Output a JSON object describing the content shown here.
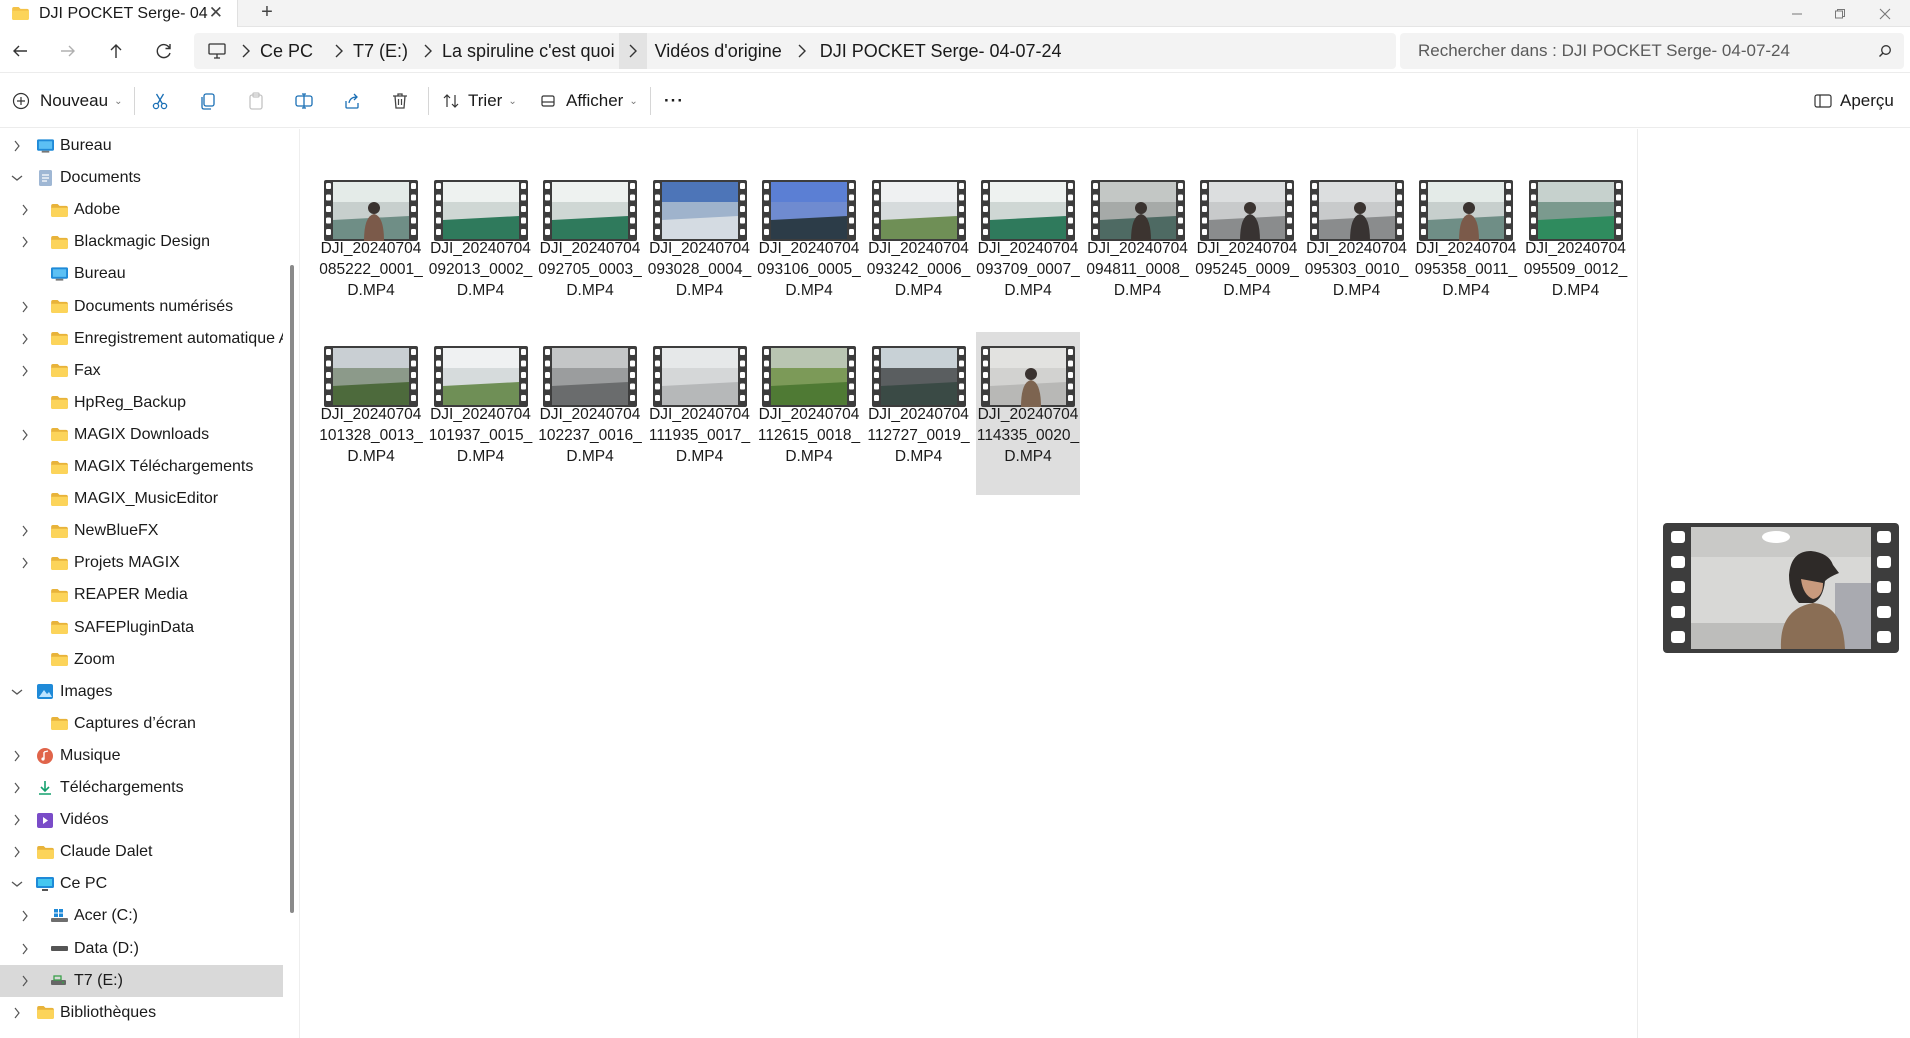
{
  "window": {
    "tab_title": "DJI POCKET Serge- 04",
    "new_tab_label": "+",
    "close_tab_label": "✕"
  },
  "address": {
    "crumbs": [
      "Ce PC",
      "T7 (E:)",
      "La spiruline c'est quoi",
      "Vidéos d'origine",
      "DJI POCKET Serge- 04-07-24"
    ]
  },
  "search": {
    "placeholder": "Rechercher dans : DJI POCKET Serge- 04-07-24"
  },
  "toolbar": {
    "new_label": "Nouveau",
    "sort_label": "Trier",
    "view_label": "Afficher",
    "more_label": "···",
    "preview_label": "Aperçu"
  },
  "nav_pane": {
    "items": [
      {
        "label": "Bureau",
        "level": 0,
        "expander": "collapsed",
        "icon": "desktop-icon"
      },
      {
        "label": "Documents",
        "level": 0,
        "expander": "expanded",
        "icon": "documents-icon"
      },
      {
        "label": "Adobe",
        "level": 1,
        "expander": "collapsed",
        "icon": "folder-icon"
      },
      {
        "label": "Blackmagic Design",
        "level": 1,
        "expander": "collapsed",
        "icon": "folder-icon"
      },
      {
        "label": "Bureau",
        "level": 1,
        "expander": "none",
        "icon": "desktop-icon"
      },
      {
        "label": "Documents numérisés",
        "level": 1,
        "expander": "collapsed",
        "icon": "folder-icon"
      },
      {
        "label": "Enregistrement automatique Ad",
        "level": 1,
        "expander": "collapsed",
        "icon": "folder-icon"
      },
      {
        "label": "Fax",
        "level": 1,
        "expander": "collapsed",
        "icon": "folder-icon"
      },
      {
        "label": "HpReg_Backup",
        "level": 1,
        "expander": "none",
        "icon": "folder-icon"
      },
      {
        "label": "MAGIX Downloads",
        "level": 1,
        "expander": "collapsed",
        "icon": "folder-icon"
      },
      {
        "label": "MAGIX Téléchargements",
        "level": 1,
        "expander": "none",
        "icon": "folder-icon"
      },
      {
        "label": "MAGIX_MusicEditor",
        "level": 1,
        "expander": "none",
        "icon": "folder-icon"
      },
      {
        "label": "NewBlueFX",
        "level": 1,
        "expander": "collapsed",
        "icon": "folder-icon"
      },
      {
        "label": "Projets MAGIX",
        "level": 1,
        "expander": "collapsed",
        "icon": "folder-icon"
      },
      {
        "label": "REAPER Media",
        "level": 1,
        "expander": "none",
        "icon": "folder-icon"
      },
      {
        "label": "SAFEPluginData",
        "level": 1,
        "expander": "none",
        "icon": "folder-icon"
      },
      {
        "label": "Zoom",
        "level": 1,
        "expander": "none",
        "icon": "folder-icon"
      },
      {
        "label": "Images",
        "level": 0,
        "expander": "expanded",
        "icon": "images-icon"
      },
      {
        "label": "Captures d’écran",
        "level": 1,
        "expander": "none",
        "icon": "folder-icon"
      },
      {
        "label": "Musique",
        "level": 0,
        "expander": "collapsed",
        "icon": "music-icon"
      },
      {
        "label": "Téléchargements",
        "level": 0,
        "expander": "collapsed",
        "icon": "download-icon"
      },
      {
        "label": "Vidéos",
        "level": 0,
        "expander": "collapsed",
        "icon": "videos-icon"
      },
      {
        "label": "Claude Dalet",
        "level": 0,
        "expander": "collapsed",
        "icon": "folder-icon"
      },
      {
        "label": "Ce PC",
        "level": 0,
        "expander": "expanded",
        "icon": "pc-icon"
      },
      {
        "label": "Acer (C:)",
        "level": 1,
        "expander": "collapsed",
        "icon": "windows-drive-icon"
      },
      {
        "label": "Data (D:)",
        "level": 1,
        "expander": "collapsed",
        "icon": "drive-icon"
      },
      {
        "label": "T7 (E:)",
        "level": 1,
        "expander": "collapsed",
        "icon": "usb-drive-icon",
        "selected": true
      },
      {
        "label": "Bibliothèques",
        "level": 0,
        "expander": "collapsed",
        "icon": "folder-icon"
      }
    ]
  },
  "files": [
    {
      "name": "DJI_20240704085222_0001_D.MP4",
      "scene": "greenhouse-person"
    },
    {
      "name": "DJI_20240704092013_0002_D.MP4",
      "scene": "greenhouse-basin"
    },
    {
      "name": "DJI_20240704092705_0003_D.MP4",
      "scene": "greenhouse-basin"
    },
    {
      "name": "DJI_20240704093028_0004_D.MP4",
      "scene": "greenhouse-exterior"
    },
    {
      "name": "DJI_20240704093106_0005_D.MP4",
      "scene": "solar-field"
    },
    {
      "name": "DJI_20240704093242_0006_D.MP4",
      "scene": "greenhouse-wall"
    },
    {
      "name": "DJI_20240704093709_0007_D.MP4",
      "scene": "greenhouse-basin"
    },
    {
      "name": "DJI_20240704094811_0008_D.MP4",
      "scene": "person-basin"
    },
    {
      "name": "DJI_20240704095245_0009_D.MP4",
      "scene": "person-room"
    },
    {
      "name": "DJI_20240704095303_0010_D.MP4",
      "scene": "person-room"
    },
    {
      "name": "DJI_20240704095358_0011_D.MP4",
      "scene": "greenhouse-person"
    },
    {
      "name": "DJI_20240704095509_0012_D.MP4",
      "scene": "green-basin"
    },
    {
      "name": "DJI_20240704101328_0013_D.MP4",
      "scene": "outdoor-building"
    },
    {
      "name": "DJI_20240704101937_0015_D.MP4",
      "scene": "greenhouse-wall"
    },
    {
      "name": "DJI_20240704102237_0016_D.MP4",
      "scene": "dark-interior"
    },
    {
      "name": "DJI_20240704111935_0017_D.MP4",
      "scene": "white-room"
    },
    {
      "name": "DJI_20240704112615_0018_D.MP4",
      "scene": "grass"
    },
    {
      "name": "DJI_20240704112727_0019_D.MP4",
      "scene": "dark-room"
    },
    {
      "name": "DJI_20240704114335_0020_D.MP4",
      "scene": "person-cap",
      "selected": true
    }
  ],
  "colors": {
    "folder": "#f4c247",
    "film": "#3d3d3d",
    "selection": "#dedede",
    "accent": "#0067c0"
  }
}
